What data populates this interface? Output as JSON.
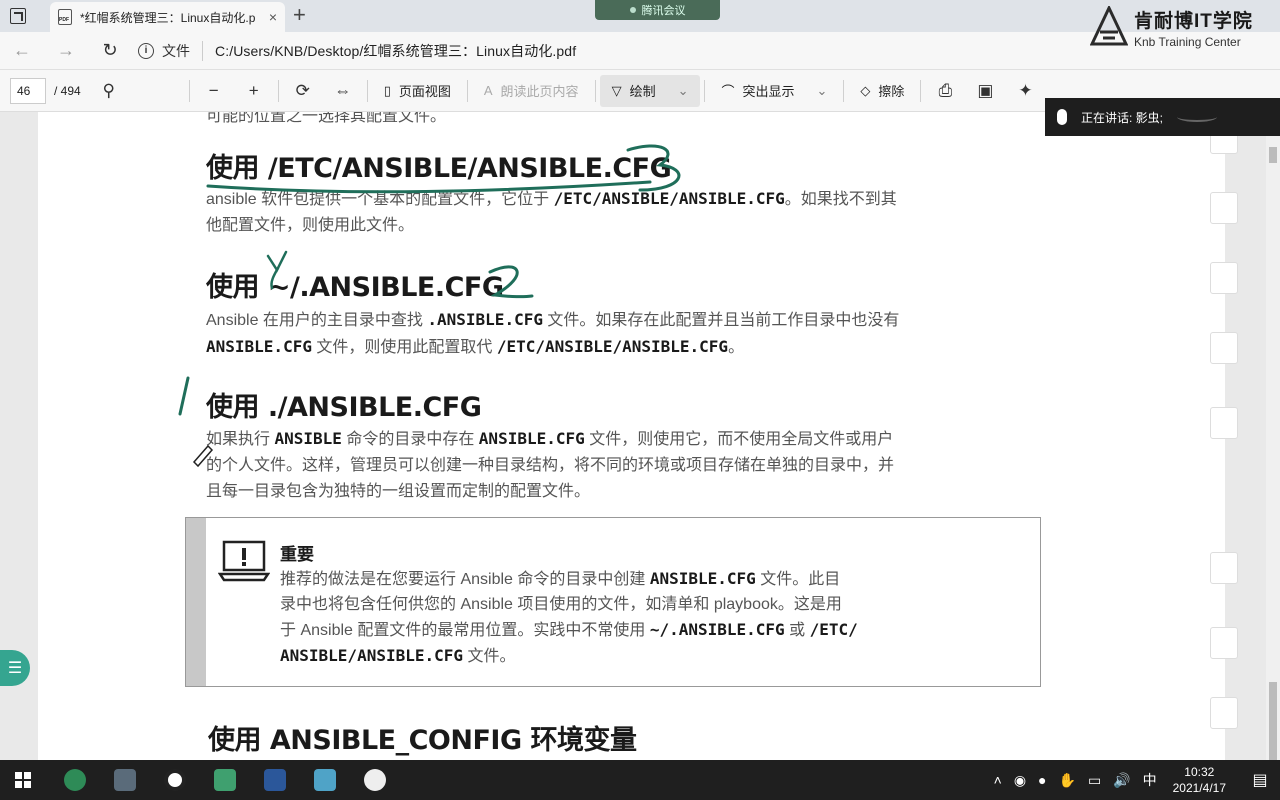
{
  "tabbar": {
    "tab_title": "*红帽系统管理三：Linux自动化.p",
    "tab_close": "×",
    "new_tab": "+",
    "meeting": "腾讯会议"
  },
  "addrbar": {
    "back": "←",
    "forward": "→",
    "reload": "↻",
    "file_label": "文件",
    "url": "C:/Users/KNB/Desktop/红帽系统管理三：Linux自动化.pdf"
  },
  "logo": {
    "cn": "肯耐博IT学院",
    "en": "Knb Training Center"
  },
  "pdf_toolbar": {
    "page_current": "46",
    "page_total": "/ 494",
    "page_view": "页面视图",
    "read_aloud": "朗读此页内容",
    "draw": "绘制",
    "highlight": "突出显示",
    "erase": "擦除"
  },
  "speaking": {
    "text": "正在讲话: 影虫;"
  },
  "document": {
    "cut_top": "可能的位置之一选择其配置文件。",
    "s1_title": "使用 /ETC/ANSIBLE/ANSIBLE.CFG",
    "s1_p1_a": "ansible 软件包提供一个基本的配置文件，它位于 ",
    "s1_p1_code": "/ETC/ANSIBLE/ANSIBLE.CFG",
    "s1_p1_b": "。如果找不到其",
    "s1_p2": "他配置文件，则使用此文件。",
    "s2_title": "使用 ~/.ANSIBLE.CFG",
    "s2_l1_a": "Ansible 在用户的主目录中查找 ",
    "s2_l1_code": ".ANSIBLE.CFG",
    "s2_l1_b": " 文件。如果存在此配置并且当前工作目录中也没有",
    "s2_l2_code1": "ANSIBLE.CFG",
    "s2_l2_a": " 文件，则使用此配置取代 ",
    "s2_l2_code2": "/ETC/ANSIBLE/ANSIBLE.CFG",
    "s2_l2_b": "。",
    "s3_title": "使用 ./ANSIBLE.CFG",
    "s3_l1_a": "如果执行 ",
    "s3_l1_code1": "ANSIBLE",
    "s3_l1_b": " 命令的目录中存在 ",
    "s3_l1_code2": "ANSIBLE.CFG",
    "s3_l1_c": " 文件，则使用它，而不使用全局文件或用户",
    "s3_l2": "的个人文件。这样，管理员可以创建一种目录结构，将不同的环境或项目存储在单独的目录中，并",
    "s3_l3": "且每一目录包含为独特的一组设置而定制的配置文件。",
    "note_title": "重要",
    "note_l1_a": "推荐的做法是在您要运行 Ansible 命令的目录中创建 ",
    "note_l1_code": "ANSIBLE.CFG",
    "note_l1_b": " 文件。此目",
    "note_l2": "录中也将包含任何供您的 Ansible 项目使用的文件，如清单和 playbook。这是用",
    "note_l3_a": "于 Ansible 配置文件的最常用位置。实践中不常使用 ",
    "note_l3_code1": "~/.ANSIBLE.CFG",
    "note_l3_b": " 或 ",
    "note_l3_code2": "/ETC/",
    "note_l4_code": "ANSIBLE/ANSIBLE.CFG",
    "note_l4_a": " 文件。",
    "s4_title": "使用 ANSIBLE_CONFIG 环境变量"
  },
  "taskbar": {
    "ime": "中",
    "time": "10:32",
    "date": "2021/4/17"
  }
}
